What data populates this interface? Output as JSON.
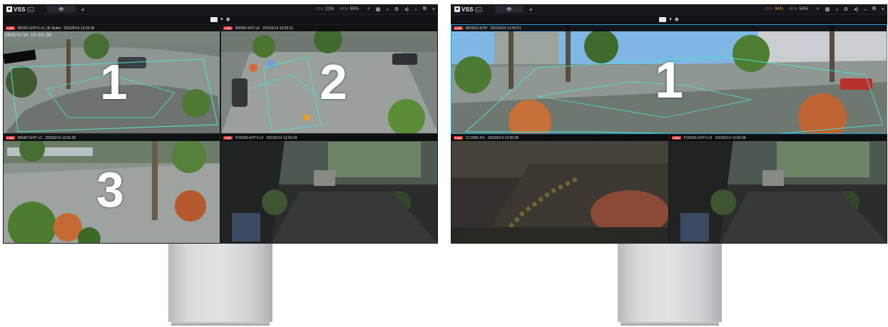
{
  "app": {
    "logo_text": "VSS",
    "logo_badge": "Pro",
    "add_tab": "+"
  },
  "left_monitor": {
    "stats": {
      "cpu_label": "CPU",
      "cpu_value": "21%",
      "mem_label": "MEM",
      "mem_value": "55%"
    },
    "tiles": [
      {
        "live": "LIVE",
        "camera": "IB9391-EHTV-v2_4K Bullet",
        "timestamp": "2023/6/14 13:55:36",
        "number": "1",
        "osd": "2023/6/14 13:55:36"
      },
      {
        "live": "LIVE",
        "camera": "IB9365-EHT-v2",
        "timestamp": "2023/6/14 13:55:21",
        "number": "2"
      },
      {
        "live": "LIVE",
        "camera": "IB9367-EHT-v2",
        "timestamp": "2023/6/14 13:55:26",
        "number": "3"
      },
      {
        "live": "LIVE",
        "camera": "FD9366-EHTV-v2",
        "timestamp": "2023/6/14 13:55:34",
        "number": ""
      }
    ]
  },
  "right_monitor": {
    "stats": {
      "cpu_label": "CPU",
      "cpu_value": "94%",
      "mem_label": "MEM",
      "mem_value": "54%"
    },
    "tiles": [
      {
        "live": "LIVE",
        "camera": "MS9321-EHV",
        "timestamp": "2023/6/14 13:50:51",
        "number": "1"
      },
      {
        "live": "LIVE",
        "camera": "CC9381-HV",
        "timestamp": "2023/6/14 13:50:38",
        "number": ""
      },
      {
        "live": "LIVE",
        "camera": "FD9366-EHTV-v2",
        "timestamp": "2023/6/14 13:50:38",
        "number": ""
      }
    ]
  },
  "toolbar_icons": [
    "search-icon",
    "grid-icon",
    "bell-icon",
    "gear-icon",
    "volume-icon",
    "minimize-icon",
    "restore-icon",
    "close-icon"
  ],
  "colors": {
    "live_badge": "#d93a3a",
    "detection_zone": "#4fe3d0",
    "cpu_warning": "#e9a24b",
    "selection": "#2a9fd6"
  }
}
